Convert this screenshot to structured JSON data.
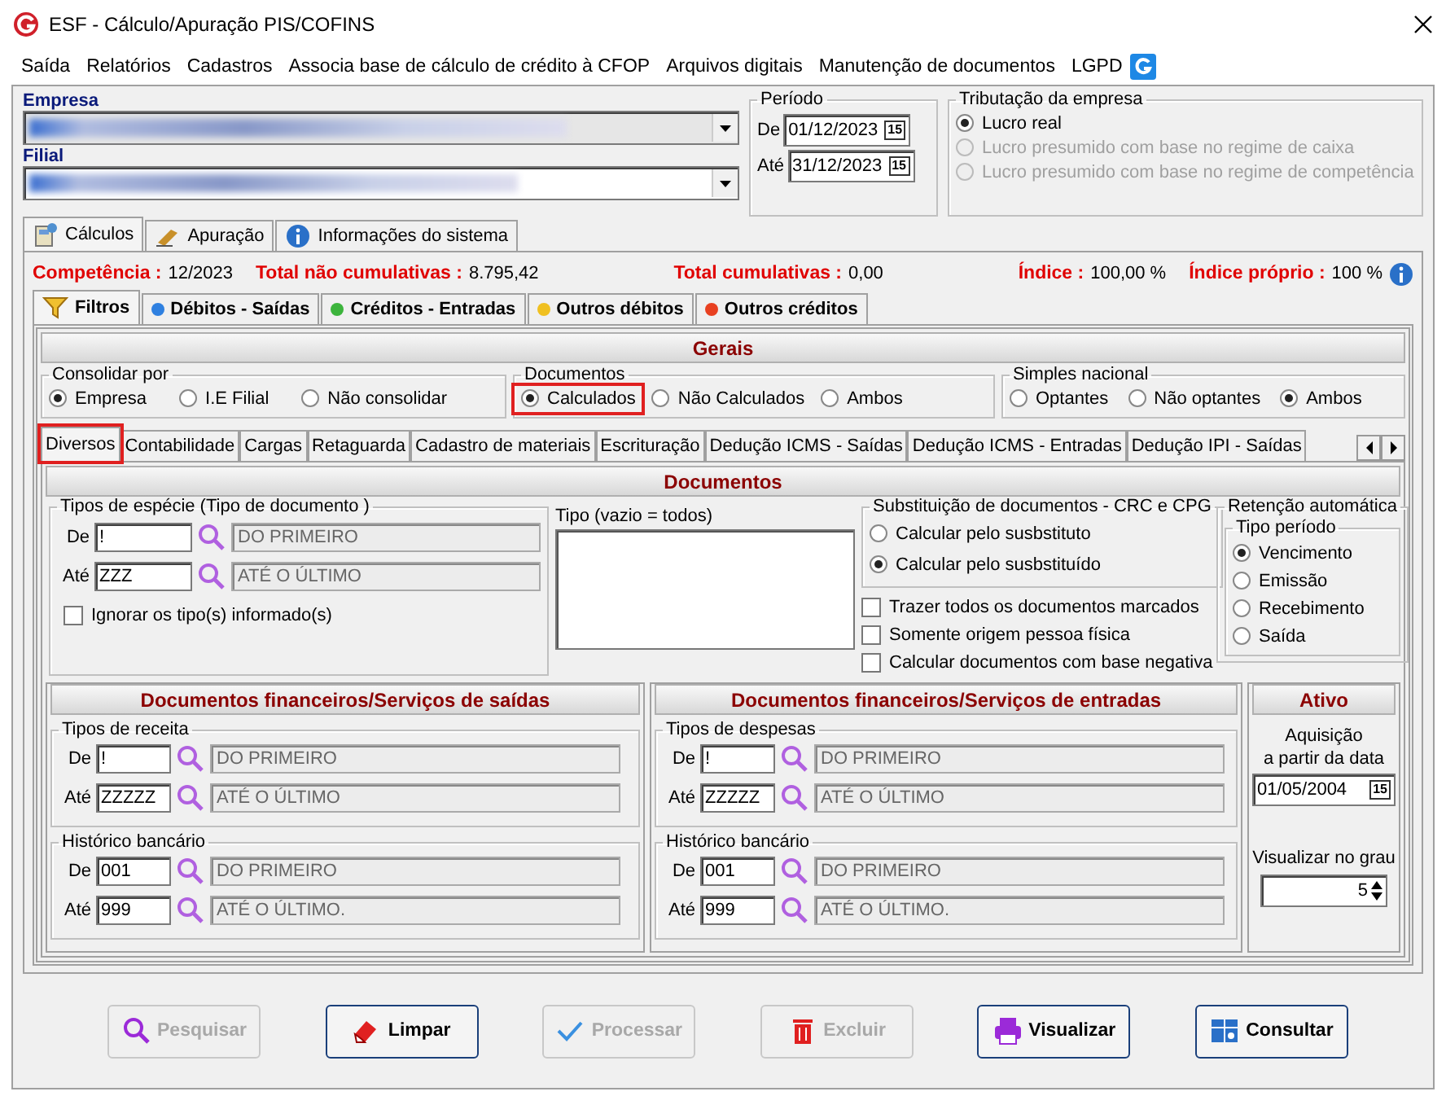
{
  "window": {
    "title": "ESF - Cálculo/Apuração PIS/COFINS"
  },
  "menu": [
    "Saída",
    "Relatórios",
    "Cadastros",
    "Associa base de cálculo de crédito à CFOP",
    "Arquivos digitais",
    "Manutenção de documentos",
    "LGPD"
  ],
  "empresa": {
    "label": "Empresa"
  },
  "filial": {
    "label": "Filial"
  },
  "periodo": {
    "title": "Período",
    "rows": [
      {
        "label": "De",
        "value": "01/12/2023",
        "picker": "15"
      },
      {
        "label": "Até",
        "value": "31/12/2023",
        "picker": "15"
      }
    ]
  },
  "tributacao": {
    "title": "Tributação da empresa",
    "options": [
      {
        "label": "Lucro real",
        "selected": true,
        "disabled": false
      },
      {
        "label": "Lucro presumido com base no regime de caixa",
        "selected": false,
        "disabled": true
      },
      {
        "label": "Lucro presumido com base no regime de competência",
        "selected": false,
        "disabled": true
      }
    ]
  },
  "main_tabs": [
    {
      "label": "Cálculos",
      "selected": true
    },
    {
      "label": "Apuração",
      "selected": false
    },
    {
      "label": "Informações do sistema",
      "selected": false
    }
  ],
  "summary": [
    {
      "label": "Competência :",
      "value": "12/2023"
    },
    {
      "label": "Total não cumulativas :",
      "value": "8.795,42"
    },
    {
      "label": "Total cumulativas :",
      "value": "0,00"
    },
    {
      "label": "Índice :",
      "value": "100,00 %"
    },
    {
      "label": "Índice próprio :",
      "value": "100 %"
    }
  ],
  "sub_tabs": [
    {
      "label": "Filtros",
      "selected": true
    },
    {
      "label": "Débitos - Saídas",
      "selected": false,
      "color": "#2f80e0"
    },
    {
      "label": "Créditos - Entradas",
      "selected": false,
      "color": "#3cb43c"
    },
    {
      "label": "Outros débitos",
      "selected": false,
      "color": "#f0c020"
    },
    {
      "label": "Outros créditos",
      "selected": false,
      "color": "#e84020"
    }
  ],
  "gerais": {
    "title": "Gerais",
    "groups": [
      {
        "title": "Consolidar por",
        "options": [
          {
            "label": "Empresa",
            "selected": true
          },
          {
            "label": "I.E Filial",
            "selected": false
          },
          {
            "label": "Não consolidar",
            "selected": false
          }
        ]
      },
      {
        "title": "Documentos",
        "options": [
          {
            "label": "Calculados",
            "selected": true,
            "highlighted": true
          },
          {
            "label": "Não Calculados",
            "selected": false
          },
          {
            "label": "Ambos",
            "selected": false
          }
        ]
      },
      {
        "title": "Simples nacional",
        "options": [
          {
            "label": "Optantes",
            "selected": false
          },
          {
            "label": "Não optantes",
            "selected": false
          },
          {
            "label": "Ambos",
            "selected": true
          }
        ]
      }
    ]
  },
  "detail_tabs": [
    {
      "label": "Diversos",
      "selected": true,
      "highlighted": true
    },
    {
      "label": "Contabilidade",
      "selected": false
    },
    {
      "label": "Cargas",
      "selected": false
    },
    {
      "label": "Retaguarda",
      "selected": false
    },
    {
      "label": "Cadastro de materiais",
      "selected": false
    },
    {
      "label": "Escrituração",
      "selected": false
    },
    {
      "label": "Dedução ICMS - Saídas",
      "selected": false
    },
    {
      "label": "Dedução ICMS - Entradas",
      "selected": false
    },
    {
      "label": "Dedução IPI - Saídas",
      "selected": false
    }
  ],
  "documentos": {
    "title": "Documentos",
    "especie": {
      "title": "Tipos de espécie (Tipo de documento )",
      "rows": [
        {
          "label": "De",
          "code": "!",
          "description": "DO PRIMEIRO"
        },
        {
          "label": "Até",
          "code": "ZZZ",
          "description": "ATÉ O ÚLTIMO"
        }
      ],
      "ignore": {
        "label": "Ignorar os tipo(s) informado(s)",
        "checked": false
      }
    },
    "tipo": {
      "label": "Tipo (vazio = todos)"
    },
    "substituicao": {
      "title": "Substituição de documentos  - CRC e CPG",
      "options": [
        {
          "label": "Calcular pelo susbstituto",
          "selected": false
        },
        {
          "label": "Calcular pelo susbstituído",
          "selected": true
        }
      ]
    },
    "checks": [
      {
        "label": "Trazer todos os documentos marcados",
        "checked": false
      },
      {
        "label": "Somente origem pessoa física",
        "checked": false
      },
      {
        "label": "Calcular documentos com base negativa",
        "checked": false
      }
    ],
    "retencao": {
      "title": "Retenção automática",
      "subtitle": "Tipo período",
      "options": [
        {
          "label": "Vencimento",
          "selected": true
        },
        {
          "label": "Emissão",
          "selected": false
        },
        {
          "label": "Recebimento",
          "selected": false
        },
        {
          "label": "Saída",
          "selected": false
        }
      ]
    }
  },
  "financeiro": [
    {
      "title": "Documentos financeiros/Serviços de saídas",
      "groups": [
        {
          "title": "Tipos de receita",
          "rows": [
            {
              "label": "De",
              "code": "!",
              "description": "DO PRIMEIRO"
            },
            {
              "label": "Até",
              "code": "ZZZZZ",
              "description": "ATÉ O ÚLTIMO"
            }
          ]
        },
        {
          "title": "Histórico bancário",
          "rows": [
            {
              "label": "De",
              "code": "001",
              "description": "DO PRIMEIRO"
            },
            {
              "label": "Até",
              "code": "999",
              "description": "ATÉ O ÚLTIMO."
            }
          ]
        }
      ]
    },
    {
      "title": "Documentos financeiros/Serviços de entradas",
      "groups": [
        {
          "title": "Tipos de despesas",
          "rows": [
            {
              "label": "De",
              "code": "!",
              "description": "DO PRIMEIRO"
            },
            {
              "label": "Até",
              "code": "ZZZZZ",
              "description": "ATÉ O ÚLTIMO"
            }
          ]
        },
        {
          "title": "Histórico bancário",
          "rows": [
            {
              "label": "De",
              "code": "001",
              "description": "DO PRIMEIRO"
            },
            {
              "label": "Até",
              "code": "999",
              "description": "ATÉ O ÚLTIMO."
            }
          ]
        }
      ]
    }
  ],
  "ativo": {
    "title": "Ativo",
    "date_label": "Aquisição\na partir da data",
    "date": "01/05/2004",
    "picker": "15",
    "grade_label": "Visualizar no grau",
    "grade": "5"
  },
  "buttons": [
    {
      "label": "Pesquisar",
      "disabled": true
    },
    {
      "label": "Limpar",
      "disabled": false
    },
    {
      "label": "Processar",
      "disabled": true
    },
    {
      "label": "Excluir",
      "disabled": true
    },
    {
      "label": "Visualizar",
      "disabled": false
    },
    {
      "label": "Consultar",
      "disabled": false
    }
  ]
}
